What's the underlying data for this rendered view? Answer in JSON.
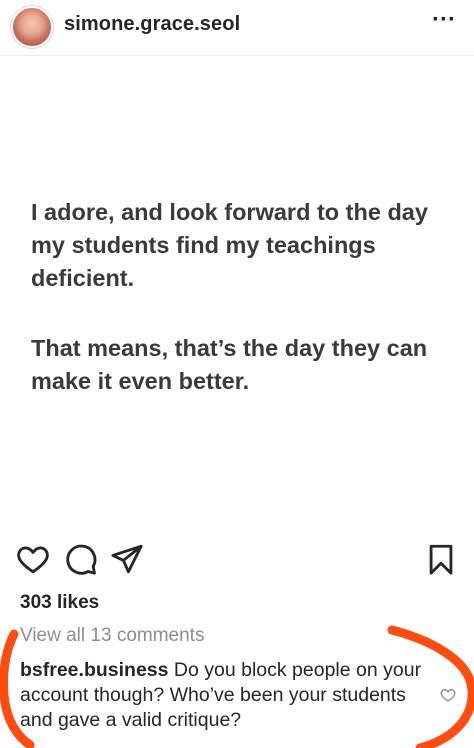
{
  "header": {
    "username": "simone.grace.seol",
    "more_label": "···",
    "avatar_icon": "avatar-photo"
  },
  "post": {
    "paragraphs": [
      "I adore, and look forward to the day my students find my teachings deficient.",
      "That means, that’s the day they can make it even better."
    ]
  },
  "actions": {
    "like_icon": "heart-icon",
    "comment_icon": "comment-icon",
    "share_icon": "send-icon",
    "save_icon": "bookmark-icon"
  },
  "likes": "303 likes",
  "view_comments": "View all 13 comments",
  "comment": {
    "username": "bsfree.business",
    "text": "Do you block people on your account though? Who’ve been your students and gave a valid critique?"
  },
  "colors": {
    "text": "#262626",
    "post_text": "#3a3a3a",
    "muted": "#8e8e8e",
    "annotation": "#ff4d12"
  }
}
